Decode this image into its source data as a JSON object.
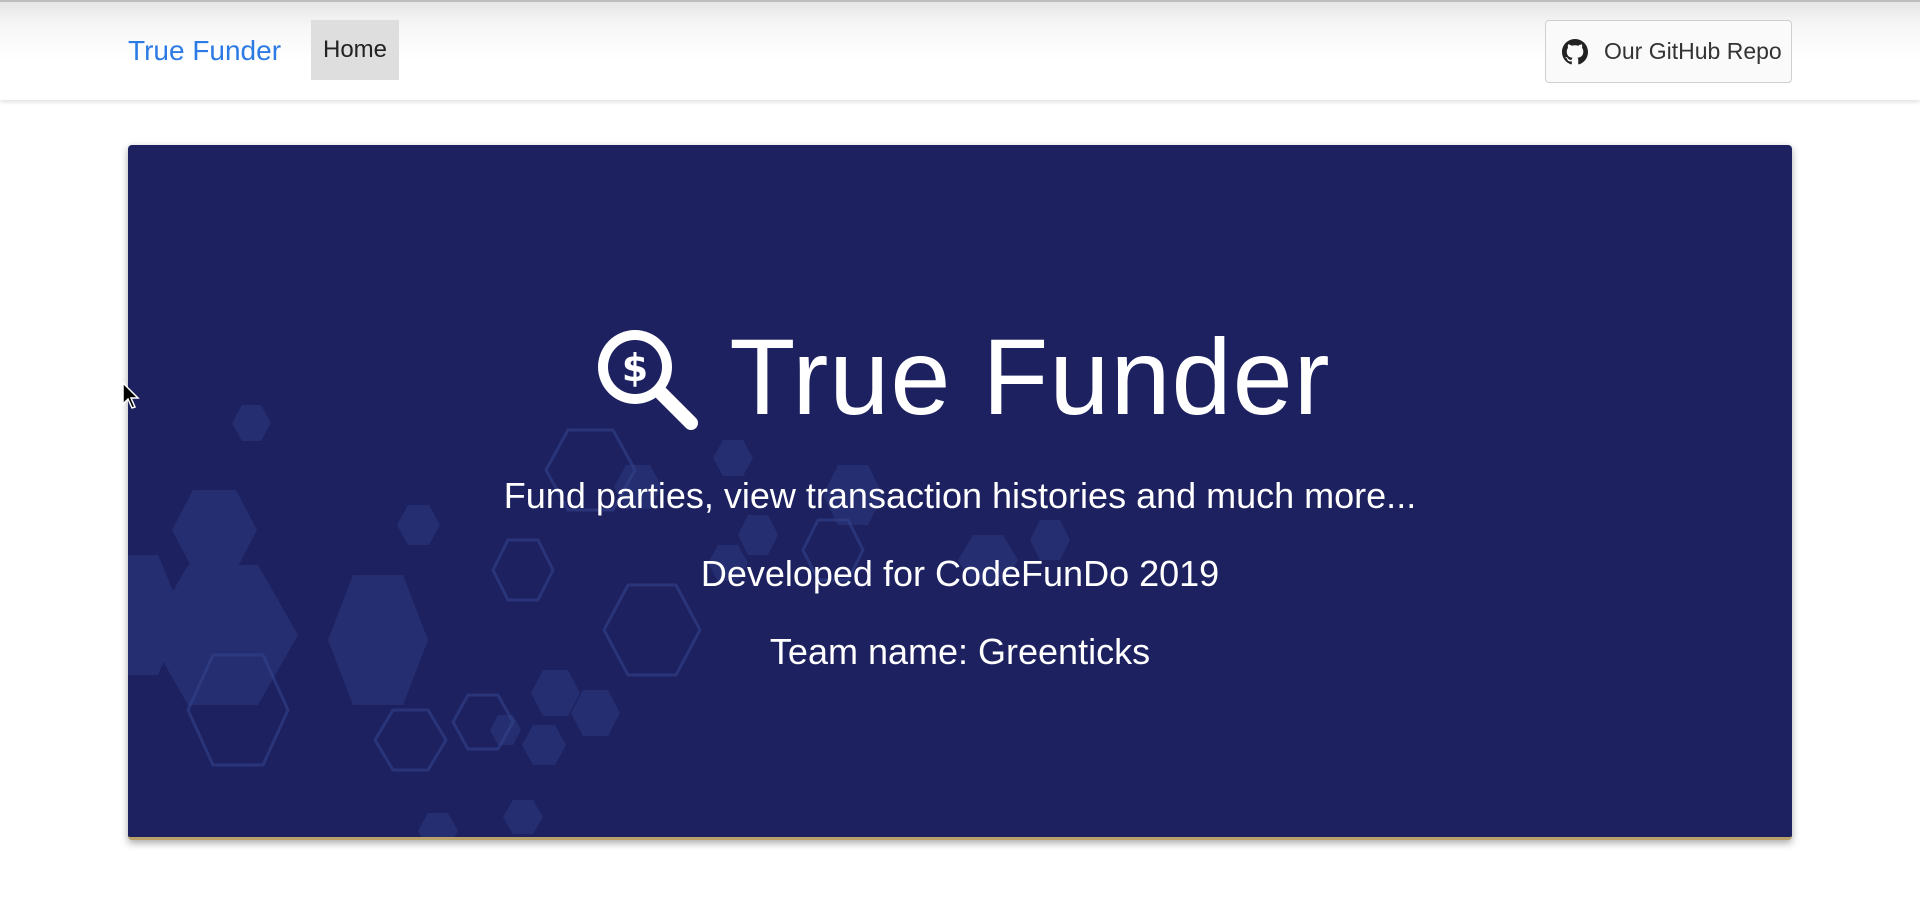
{
  "navbar": {
    "brand": "True Funder",
    "home_label": "Home",
    "github_label": "Our GitHub Repo",
    "github_icon": "github-icon"
  },
  "hero": {
    "logo_icon": "search-dollar-icon",
    "title": "True Funder",
    "tagline": "Fund parties, view transaction histories and much more...",
    "developed_for": "Developed for CodeFunDo 2019",
    "team": "Team name: Greenticks",
    "background_color": "#1d2160"
  },
  "colors": {
    "brand": "#2c7be5",
    "nav_active_bg": "#dedede"
  }
}
